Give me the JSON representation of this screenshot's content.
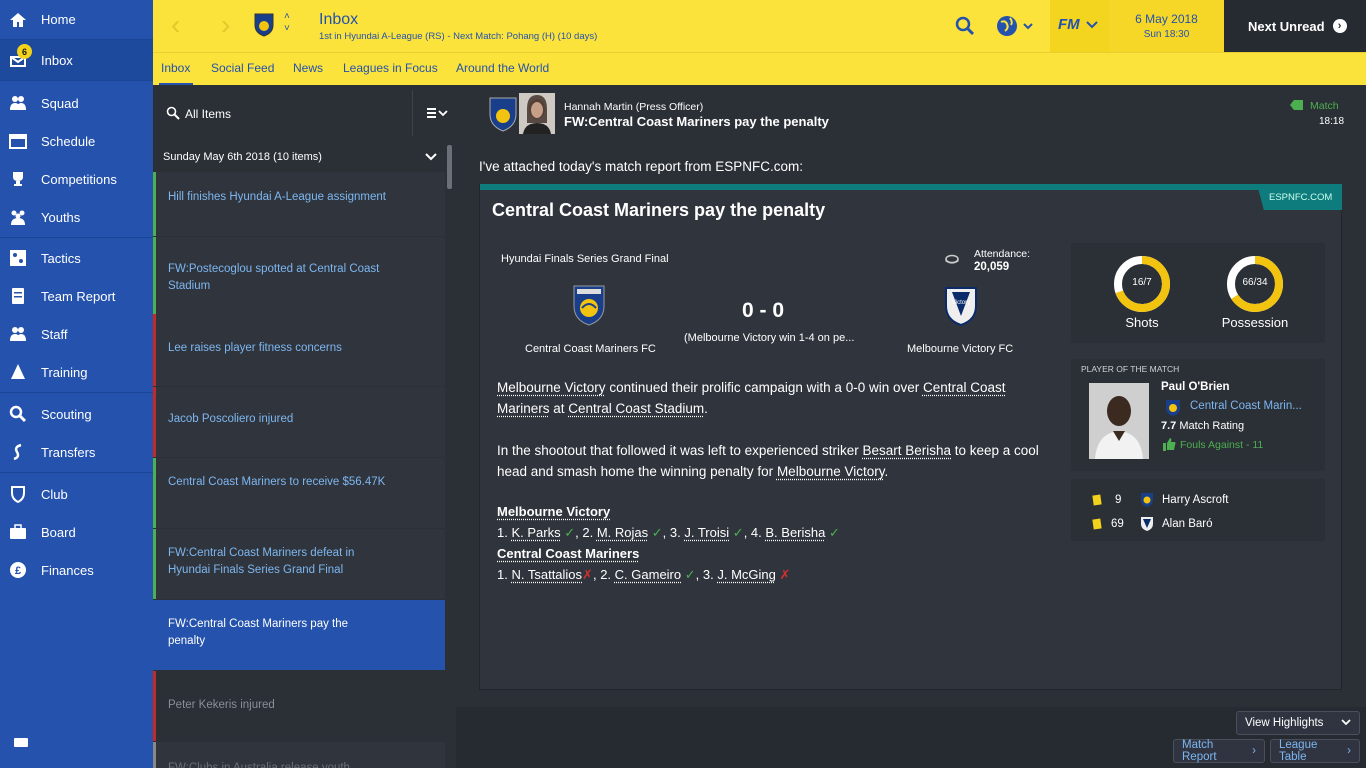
{
  "sidebar": {
    "items": [
      {
        "label": "Home",
        "icon": "home-icon"
      },
      {
        "label": "Inbox",
        "icon": "inbox-icon",
        "badge": "6"
      },
      {
        "label": "Squad",
        "icon": "squad-icon"
      },
      {
        "label": "Schedule",
        "icon": "schedule-icon"
      },
      {
        "label": "Competitions",
        "icon": "trophy-icon"
      },
      {
        "label": "Youths",
        "icon": "youths-icon"
      },
      {
        "label": "Tactics",
        "icon": "tactics-icon"
      },
      {
        "label": "Team Report",
        "icon": "report-icon"
      },
      {
        "label": "Staff",
        "icon": "staff-icon"
      },
      {
        "label": "Training",
        "icon": "training-icon"
      },
      {
        "label": "Scouting",
        "icon": "search-icon"
      },
      {
        "label": "Transfers",
        "icon": "transfers-icon"
      },
      {
        "label": "Club",
        "icon": "shield-icon"
      },
      {
        "label": "Board",
        "icon": "board-icon"
      },
      {
        "label": "Finances",
        "icon": "finances-icon"
      }
    ]
  },
  "header": {
    "title": "Inbox",
    "subtitle": "1st in Hyundai A-League (RS) - Next Match: Pohang (H) (10 days)",
    "fm_label": "FM",
    "date": "6 May 2018",
    "time": "Sun 18:30",
    "next_unread": "Next Unread"
  },
  "subnav": {
    "tabs": [
      "Inbox",
      "Social Feed",
      "News",
      "Leagues in Focus",
      "Around the World"
    ]
  },
  "list": {
    "filter_label": "All Items",
    "group_label": "Sunday May 6th 2018 (10 items)",
    "messages": [
      {
        "text": "Hill finishes Hyundai A-League assignment",
        "color": "#4caf50"
      },
      {
        "text": "FW:Postecoglou spotted at Central Coast Stadium",
        "color": "#4caf50"
      },
      {
        "text": "Lee raises player fitness concerns",
        "color": "#c62828"
      },
      {
        "text": "Jacob Poscoliero injured",
        "color": "#c62828"
      },
      {
        "text": "Central Coast Mariners to receive $56.47K",
        "color": "#4caf50"
      },
      {
        "text": "FW:Central Coast Mariners defeat in Hyundai Finals Series Grand Final",
        "color": "#4caf50"
      },
      {
        "text": "FW:Central Coast Mariners pay the penalty",
        "color": "#2452ad"
      },
      {
        "text": "Peter Kekeris injured",
        "color": "#c62828"
      },
      {
        "text": "FW:Clubs in Australia release youth",
        "color": "#888888"
      }
    ]
  },
  "message": {
    "sender": "Hannah Martin  (Press Officer)",
    "subject": "FW:Central Coast Mariners pay the penalty",
    "tag": "Match",
    "tag_time": "18:18",
    "intro": "I've attached today's match report from ESPNFC.com:",
    "source": "ESPNFC.COM",
    "headline": "Central Coast Mariners pay the penalty",
    "competition": "Hyundai Finals Series Grand Final",
    "attendance_label": "Attendance:",
    "attendance": "20,059",
    "home_team": "Central Coast Mariners FC",
    "away_team": "Melbourne Victory FC",
    "score": "0 - 0",
    "score_note": "(Melbourne Victory win 1-4 on pe...",
    "para1": {
      "t1": "Melbourne Victory",
      "t2": " continued their prolific campaign with a 0-0 win over ",
      "t3": "Central Coast Mariners",
      "t4": " at ",
      "t5": "Central Coast Stadium",
      "t6": "."
    },
    "para2": {
      "t1": "In the shootout that followed it was left to experienced striker ",
      "t2": "Besart Berisha",
      "t3": " to keep a cool head and smash home the winning penalty for ",
      "t4": "Melbourne Victory",
      "t5": "."
    },
    "shootout": {
      "team1": "Melbourne Victory",
      "team1_kicks": [
        {
          "n": "1.",
          "name": "K. Parks",
          "ok": true
        },
        {
          "n": "2.",
          "name": "M. Rojas",
          "ok": true
        },
        {
          "n": "3.",
          "name": "J. Troisi",
          "ok": true
        },
        {
          "n": "4.",
          "name": "B. Berisha",
          "ok": true
        }
      ],
      "team2": "Central Coast Mariners",
      "team2_kicks": [
        {
          "n": "1.",
          "name": "N. Tsattalios",
          "ok": false
        },
        {
          "n": "2.",
          "name": "C. Gameiro",
          "ok": true
        },
        {
          "n": "3.",
          "name": "J. McGing",
          "ok": false
        }
      ]
    },
    "stats": {
      "shots_value": "16/7",
      "shots_label": "Shots",
      "possession_value": "66/34",
      "possession_label": "Possession",
      "shots_home_fraction": 0.696,
      "possession_home_fraction": 0.66
    },
    "potm": {
      "heading": "PLAYER OF THE MATCH",
      "name": "Paul O'Brien",
      "club": "Central Coast Marin...",
      "rating_value": "7.7",
      "rating_label": "Match Rating",
      "fouls": "Fouls Against - 11"
    },
    "cards": [
      {
        "minute": "9",
        "player": "Harry Ascroft"
      },
      {
        "minute": "69",
        "player": "Alan Baró"
      }
    ],
    "buttons": {
      "highlights": "View Highlights",
      "match_report": "Match Report",
      "league_table": "League Table"
    }
  },
  "colors": {
    "accent": "#2452ad",
    "header": "#fbe33c",
    "ring": "#f2c40f"
  }
}
